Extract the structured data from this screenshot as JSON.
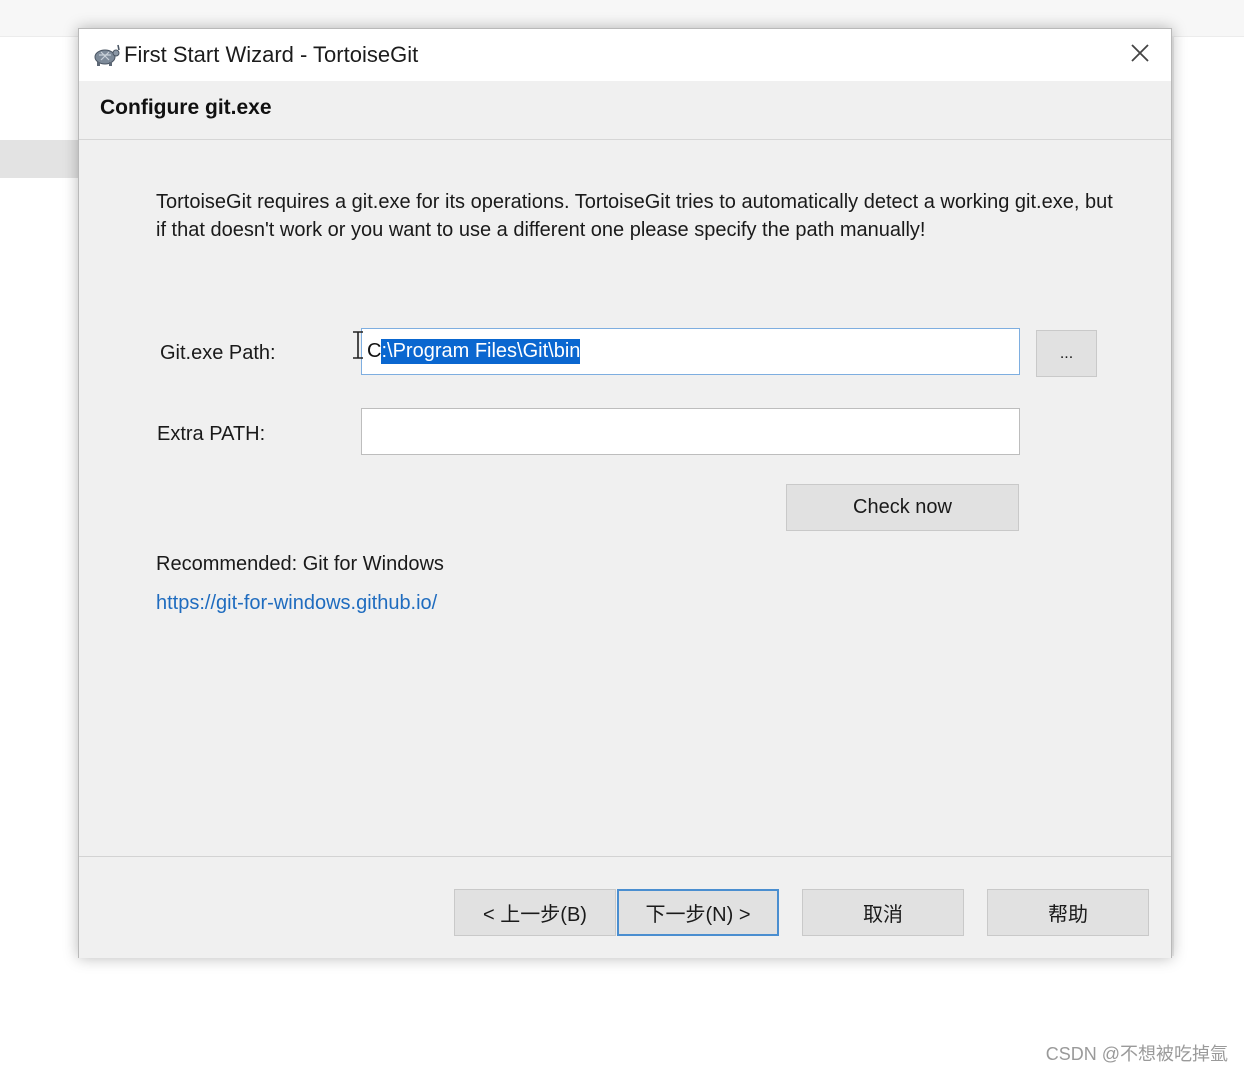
{
  "dialog": {
    "title": "First Start Wizard - TortoiseGit",
    "app_icon": "tortoise-icon",
    "close_icon": "close-icon",
    "page_title": "Configure git.exe",
    "description": "TortoiseGit requires a git.exe for its operations. TortoiseGit tries to automatically detect a working git.exe, but if that doesn't work or you want to use a different one please specify the path manually!",
    "git_path": {
      "label": "Git.exe Path:",
      "value_unselected": "C",
      "value_selected": ":\\Program Files\\Git\\bin",
      "browse_label": "..."
    },
    "extra_path": {
      "label": "Extra PATH:",
      "value": ""
    },
    "check_now_label": "Check now",
    "recommended_text": "Recommended: Git for Windows",
    "recommended_link": "https://git-for-windows.github.io/",
    "footer": {
      "back_label": "< 上一步(B)",
      "next_label": "下一步(N) >",
      "cancel_label": "取消",
      "help_label": "帮助"
    }
  },
  "watermark": "CSDN @不想被吃掉氩",
  "colors": {
    "selection": "#0a67d0",
    "link": "#1f6cbf",
    "default_button_border": "#4a8ed0"
  }
}
